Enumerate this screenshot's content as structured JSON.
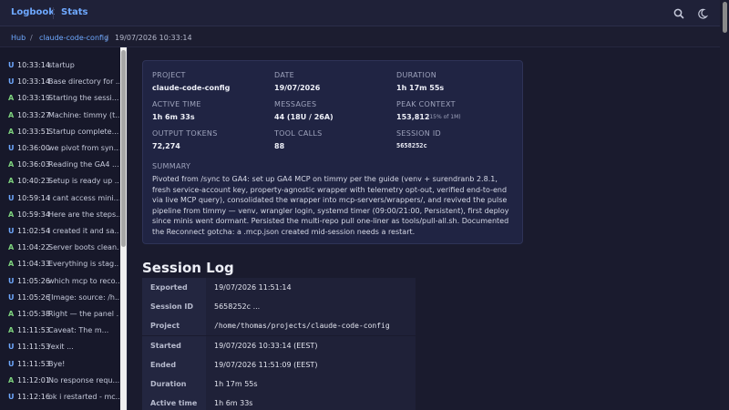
{
  "header": {
    "brand": "Logbook",
    "nav_stats": "Stats",
    "search_icon": "search-icon",
    "theme_icon": "moon-icon"
  },
  "breadcrumb": {
    "hub": "Hub",
    "sep": "/",
    "project": "claude-code-config",
    "session": "19/07/2026 10:33:14"
  },
  "sidebar": {
    "items": [
      {
        "role": "U",
        "time": "10:33:14",
        "text": "startup"
      },
      {
        "role": "U",
        "time": "10:33:14",
        "text": "Base directory for ..."
      },
      {
        "role": "A",
        "time": "10:33:19",
        "text": "Starting the sessi..."
      },
      {
        "role": "A",
        "time": "10:33:27",
        "text": "Machine: timmy (t..."
      },
      {
        "role": "A",
        "time": "10:33:51",
        "text": "Startup complete...."
      },
      {
        "role": "U",
        "time": "10:36:00",
        "text": "we pivot from syn..."
      },
      {
        "role": "A",
        "time": "10:36:03",
        "text": "Reading the GA4 ..."
      },
      {
        "role": "A",
        "time": "10:40:23",
        "text": "Setup is ready up ..."
      },
      {
        "role": "U",
        "time": "10:59:14",
        "text": "i cant access mini..."
      },
      {
        "role": "A",
        "time": "10:59:34",
        "text": "Here are the steps..."
      },
      {
        "role": "U",
        "time": "11:02:54",
        "text": "i created it and sa..."
      },
      {
        "role": "A",
        "time": "11:04:22",
        "text": "Server boots clean..."
      },
      {
        "role": "A",
        "time": "11:04:33",
        "text": "Everything is stag..."
      },
      {
        "role": "U",
        "time": "11:05:26",
        "text": "which mcp to reco..."
      },
      {
        "role": "U",
        "time": "11:05:26",
        "text": "[Image: source: /h..."
      },
      {
        "role": "A",
        "time": "11:05:38",
        "text": "Right — the panel ..."
      },
      {
        "role": "A",
        "time": "11:11:53",
        "text": "Caveat: The m..."
      },
      {
        "role": "U",
        "time": "11:11:53",
        "text": "/exit ..."
      },
      {
        "role": "U",
        "time": "11:11:53",
        "text": "Bye!"
      },
      {
        "role": "A",
        "time": "11:12:01",
        "text": "No response requ..."
      },
      {
        "role": "U",
        "time": "11:12:16",
        "text": "ok i restarted - mc..."
      }
    ]
  },
  "summary_card": {
    "project_label": "PROJECT",
    "project": "claude-code-config",
    "date_label": "DATE",
    "date": "19/07/2026",
    "duration_label": "DURATION",
    "duration": "1h 17m 55s",
    "active_label": "ACTIVE TIME",
    "active": "1h 6m 33s",
    "messages_label": "MESSAGES",
    "messages": "44 (18U / 26A)",
    "peak_label": "PEAK CONTEXT",
    "peak": "153,812",
    "peak_note": "(15% of 1M)",
    "output_label": "OUTPUT TOKENS",
    "output": "72,274",
    "tools_label": "TOOL CALLS",
    "tools": "88",
    "session_label": "SESSION ID",
    "session": "5658252c",
    "summary_label": "SUMMARY",
    "summary": "Pivoted from /sync to GA4: set up GA4 MCP on timmy per the guide (venv + surendranb 2.8.1, fresh service-account key, property-agnostic wrapper with telemetry opt-out, verified end-to-end via live MCP query), consolidated the wrapper into mcp-servers/wrappers/, and revived the pulse pipeline from timmy — venv, wrangler login, systemd timer (09:00/21:00, Persistent), first deploy since minis went dormant. Persisted the multi-repo pull one-liner as tools/pull-all.sh. Documented the Reconnect gotcha: a .mcp.json created mid-session needs a restart."
  },
  "session_log": {
    "title": "Session Log",
    "rows": [
      {
        "key": "Exported",
        "value": "19/07/2026 11:51:14"
      },
      {
        "key": "Session ID",
        "value": "5658252c ..."
      },
      {
        "key": "Project",
        "value": "/home/thomas/projects/claude-code-config"
      },
      {
        "key": "Started",
        "value": "19/07/2026 10:33:14 (EEST)"
      },
      {
        "key": "Ended",
        "value": "19/07/2026 11:51:09 (EEST)"
      },
      {
        "key": "Duration",
        "value": "1h 17m 55s"
      },
      {
        "key": "Active time",
        "value": "1h 6m 33s"
      }
    ]
  }
}
